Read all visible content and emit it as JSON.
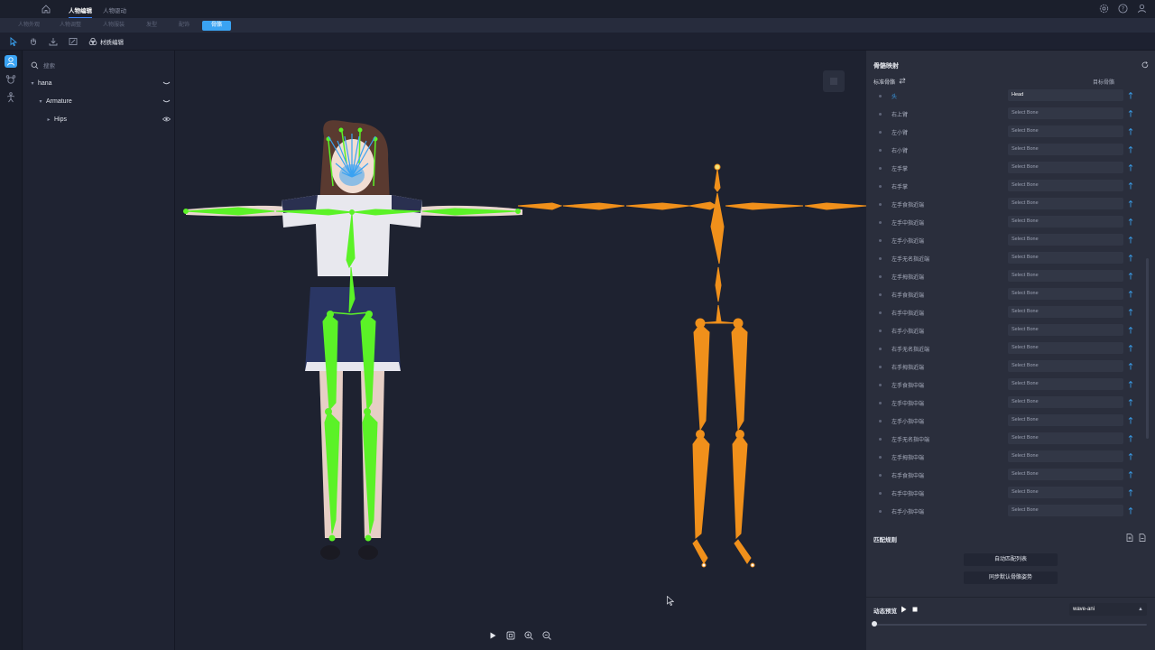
{
  "topbar": {
    "tabs": [
      {
        "label": "人物编辑",
        "active": true
      },
      {
        "label": "人物驱动",
        "active": false
      }
    ],
    "icons": [
      "home-icon",
      "settings-icon",
      "help-icon",
      "user-icon"
    ]
  },
  "subbar": {
    "tabs": [
      {
        "label": "人物外观",
        "active": false
      },
      {
        "label": "人物调整",
        "active": false
      },
      {
        "label": "人物服装",
        "active": false
      },
      {
        "label": "发型",
        "active": false
      },
      {
        "label": "配饰",
        "active": false
      },
      {
        "label": "骨骼",
        "active": true
      }
    ]
  },
  "toolbar": {
    "tools": [
      "select-tool-icon",
      "hand-tool-icon",
      "download-icon",
      "frame-icon"
    ],
    "material_label": "材质编辑"
  },
  "outliner": {
    "search_placeholder": "搜索",
    "rows": [
      {
        "label": "hana",
        "expanded": true
      },
      {
        "label": "Armature",
        "expanded": true
      },
      {
        "label": "Hips",
        "expanded": false
      }
    ]
  },
  "viewport": {
    "controls": [
      "play-icon",
      "fit-view-icon",
      "zoom-in-icon",
      "zoom-out-icon"
    ],
    "colors": {
      "source_skeleton": "#5bf227",
      "target_skeleton": "#f0901b",
      "head_bones": "#3aa3f2"
    }
  },
  "bone_mapping": {
    "title": "骨骼映射",
    "standard_header": "标准骨骼",
    "target_header": "目标骨骼",
    "rows": [
      {
        "name": "头",
        "value": "Head"
      },
      {
        "name": "右上臂",
        "value": "Select Bone"
      },
      {
        "name": "左小臂",
        "value": "Select Bone"
      },
      {
        "name": "右小臂",
        "value": "Select Bone"
      },
      {
        "name": "左手掌",
        "value": "Select Bone"
      },
      {
        "name": "右手掌",
        "value": "Select Bone"
      },
      {
        "name": "左手食指近端",
        "value": "Select Bone"
      },
      {
        "name": "左手中指近端",
        "value": "Select Bone"
      },
      {
        "name": "左手小指近端",
        "value": "Select Bone"
      },
      {
        "name": "左手无名指近端",
        "value": "Select Bone"
      },
      {
        "name": "左手拇指近端",
        "value": "Select Bone"
      },
      {
        "name": "右手食指近端",
        "value": "Select Bone"
      },
      {
        "name": "右手中指近端",
        "value": "Select Bone"
      },
      {
        "name": "右手小指近端",
        "value": "Select Bone"
      },
      {
        "name": "右手无名指近端",
        "value": "Select Bone"
      },
      {
        "name": "右手拇指近端",
        "value": "Select Bone"
      },
      {
        "name": "左手食指中端",
        "value": "Select Bone"
      },
      {
        "name": "左手中指中端",
        "value": "Select Bone"
      },
      {
        "name": "左手小指中端",
        "value": "Select Bone"
      },
      {
        "name": "左手无名指中端",
        "value": "Select Bone"
      },
      {
        "name": "左手拇指中端",
        "value": "Select Bone"
      },
      {
        "name": "右手食指中端",
        "value": "Select Bone"
      },
      {
        "name": "右手中指中端",
        "value": "Select Bone"
      },
      {
        "name": "右手小指中端",
        "value": "Select Bone"
      }
    ]
  },
  "match_rules": {
    "title": "匹配规则",
    "auto_match_label": "自动匹配列表",
    "sync_pose_label": "同步默认骨骼姿势"
  },
  "animation_preview": {
    "label": "动态预览",
    "selected": "wave-ani",
    "progress": 0
  }
}
